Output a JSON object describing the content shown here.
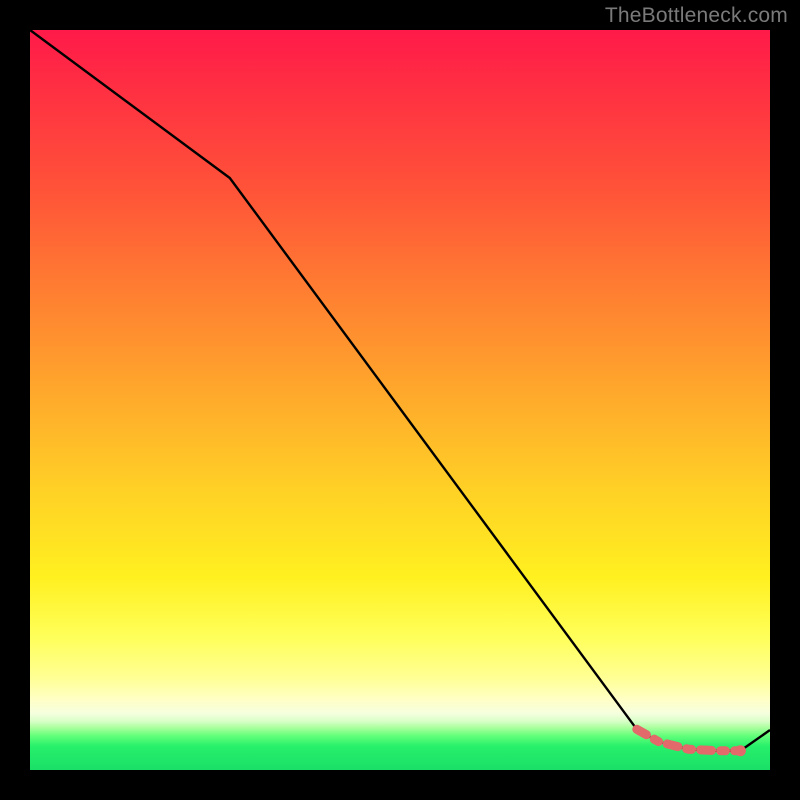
{
  "watermark": "TheBottleneck.com",
  "colors": {
    "page_bg": "#000000",
    "line": "#000000",
    "dash": "#e26a6a",
    "gradient_top": "#ff1a49",
    "gradient_bottom": "#1adf68"
  },
  "chart_data": {
    "type": "line",
    "title": "",
    "xlabel": "",
    "ylabel": "",
    "xlim": [
      0,
      100
    ],
    "ylim": [
      0,
      100
    ],
    "series": [
      {
        "name": "main-curve",
        "x": [
          0,
          27,
          82,
          85,
          89,
          93,
          96,
          100
        ],
        "y": [
          100,
          80,
          5.5,
          3.8,
          2.8,
          2.6,
          2.6,
          5.4
        ]
      },
      {
        "name": "highlight-dashed",
        "x": [
          82,
          85,
          89,
          93,
          96
        ],
        "y": [
          5.5,
          3.8,
          2.8,
          2.6,
          2.6
        ]
      }
    ],
    "annotations": [
      {
        "type": "point",
        "x": 96,
        "y": 2.6,
        "name": "end-dot"
      }
    ]
  }
}
